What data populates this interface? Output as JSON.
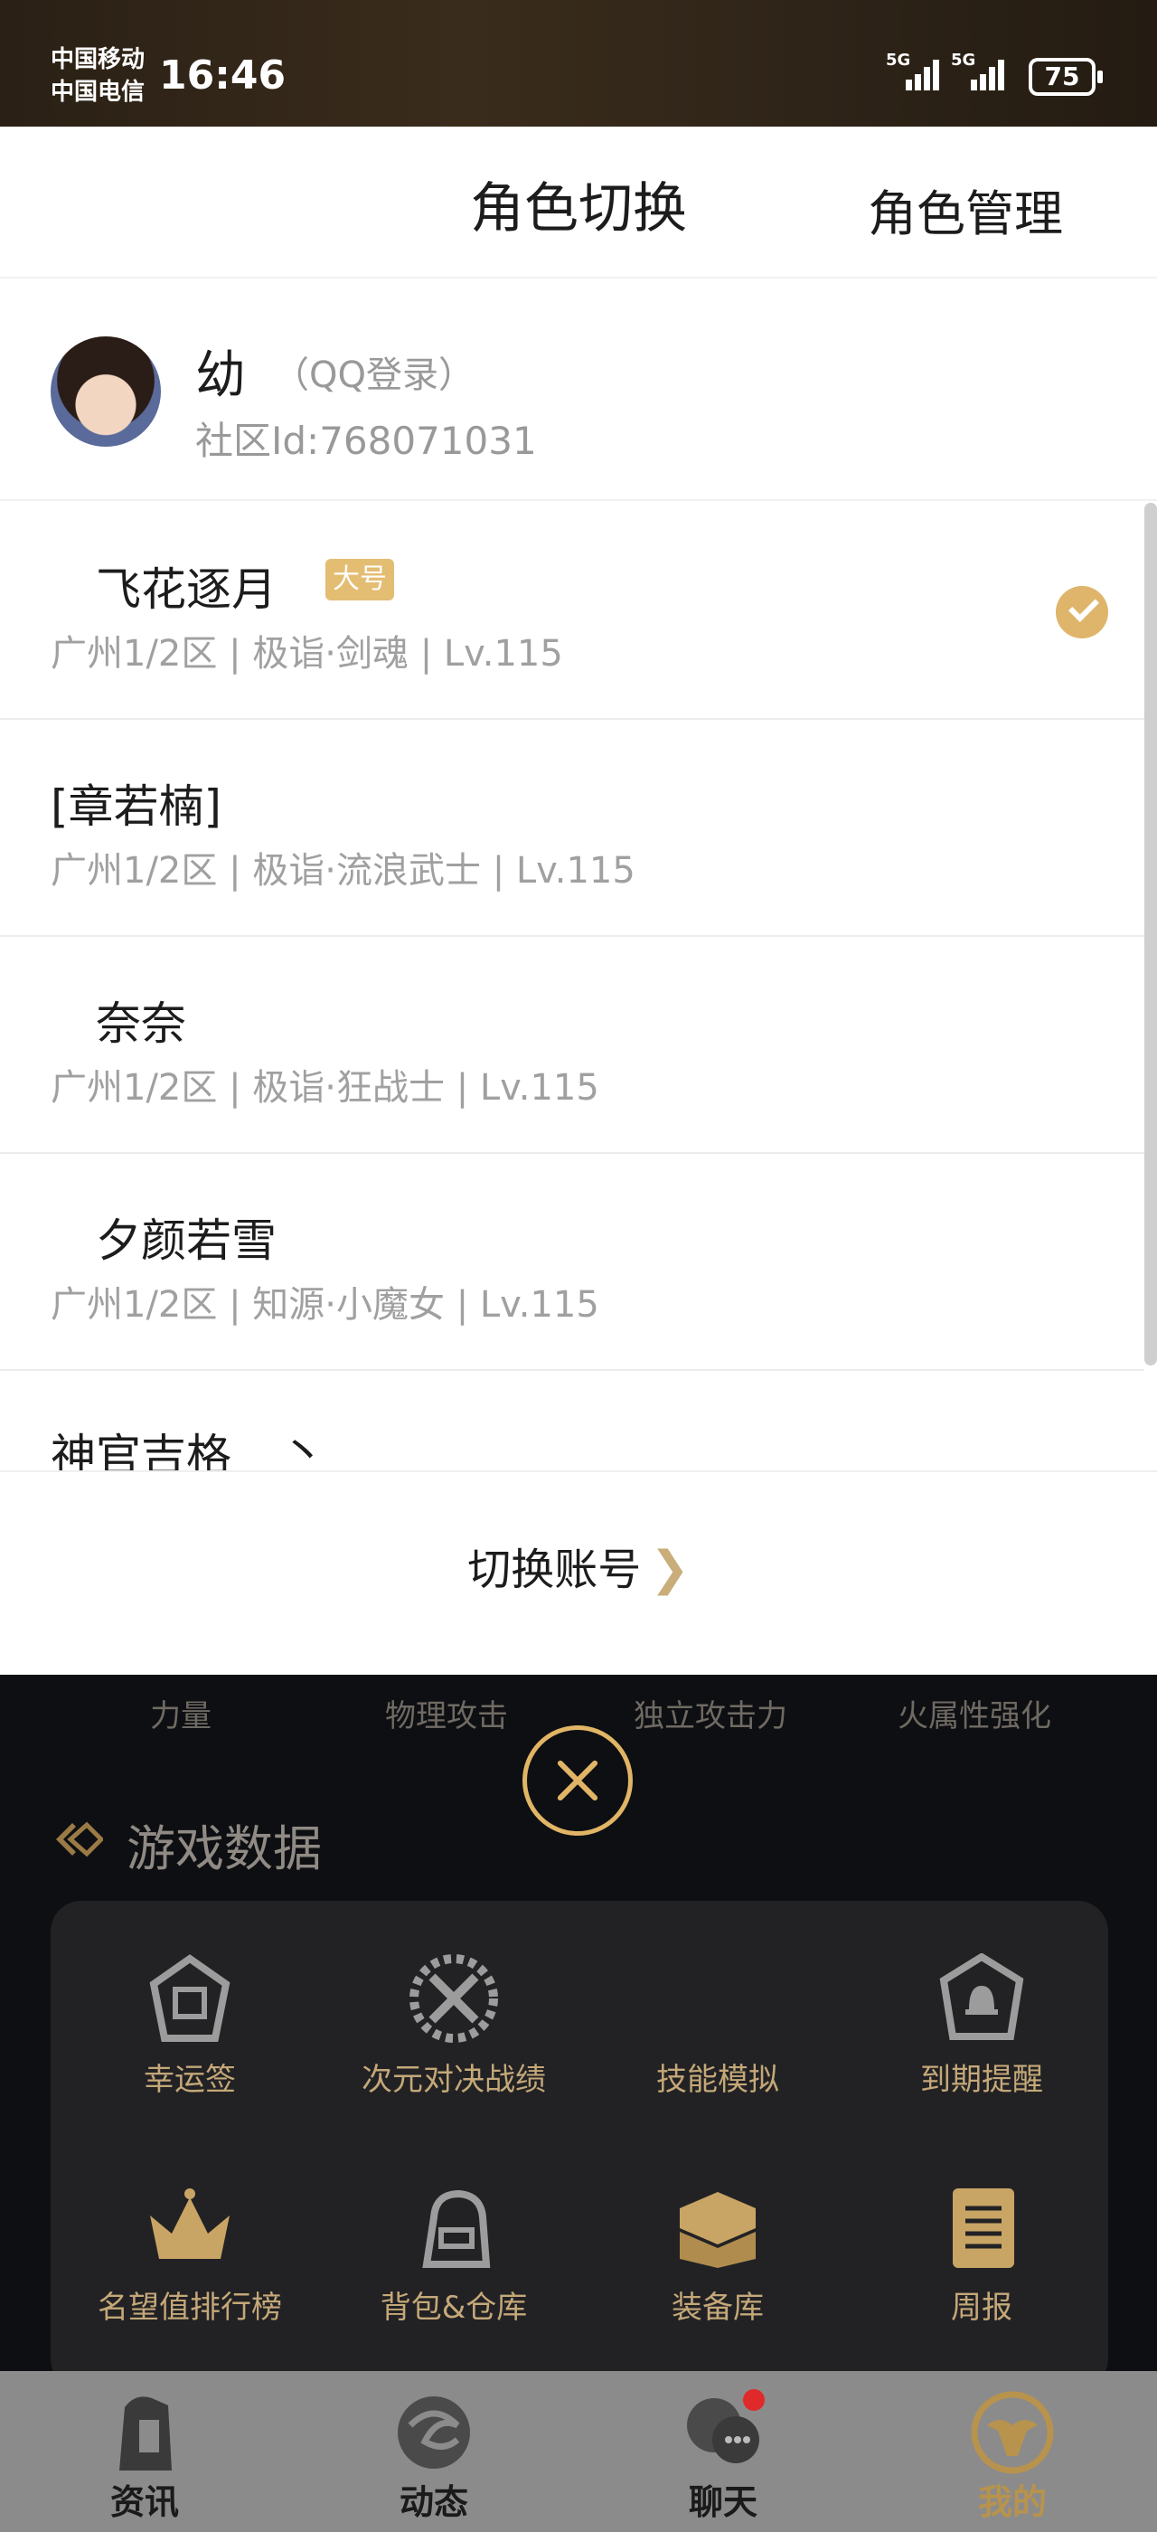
{
  "status_bar": {
    "carrier_1": "中国移动",
    "carrier_2": "中国电信",
    "time": "16:46",
    "network_1": "5G",
    "network_2": "5G",
    "battery": "75"
  },
  "sheet": {
    "title": "角色切换",
    "manage_label": "角色管理",
    "account": {
      "name": "幼",
      "login_method": "（QQ登录）",
      "community_id": "社区Id:768071031"
    },
    "roles": [
      {
        "name": "飞花逐月",
        "badge": "大号",
        "detail": "广州1/2区 | 极诣·剑魂 | Lv.115",
        "selected": true
      },
      {
        "name": "[章若楠]",
        "detail": "广州1/2区 | 极诣·流浪武士 | Lv.115",
        "selected": false
      },
      {
        "name": "奈奈",
        "detail": "广州1/2区 | 极诣·狂战士 | Lv.115",
        "selected": false
      },
      {
        "name": "夕颜若雪",
        "detail": "广州1/2区 | 知源·小魔女 | Lv.115",
        "selected": false
      },
      {
        "name": "神官吉格",
        "suffix": "丶"
      }
    ],
    "switch_account_label": "切换账号"
  },
  "background": {
    "stats": [
      "力量",
      "物理攻击",
      "独立攻击力",
      "火属性强化"
    ],
    "section_title": "游戏数据",
    "tools": [
      "幸运签",
      "次元对决战绩",
      "技能模拟",
      "到期提醒",
      "名望值排行榜",
      "背包&仓库",
      "装备库",
      "周报"
    ]
  },
  "bottom_nav": {
    "items": [
      "资讯",
      "动态",
      "聊天",
      "我的"
    ],
    "active": "我的"
  },
  "colors": {
    "accent_gold": "#dfb56b",
    "badge_gold": "#e3bd72",
    "dark_bg": "#0e0f12",
    "panel_bg": "#222225",
    "notification_red": "#e02a2a"
  },
  "icons": [
    "check-circle-icon",
    "close-circle-icon",
    "arrow-right-icon",
    "fortune-stick-icon",
    "dimension-battle-icon",
    "bell-icon",
    "crown-icon",
    "backpack-icon",
    "treasure-chest-icon",
    "scroll-icon",
    "news-icon",
    "dragon-icon",
    "chat-icon",
    "profile-icon"
  ]
}
